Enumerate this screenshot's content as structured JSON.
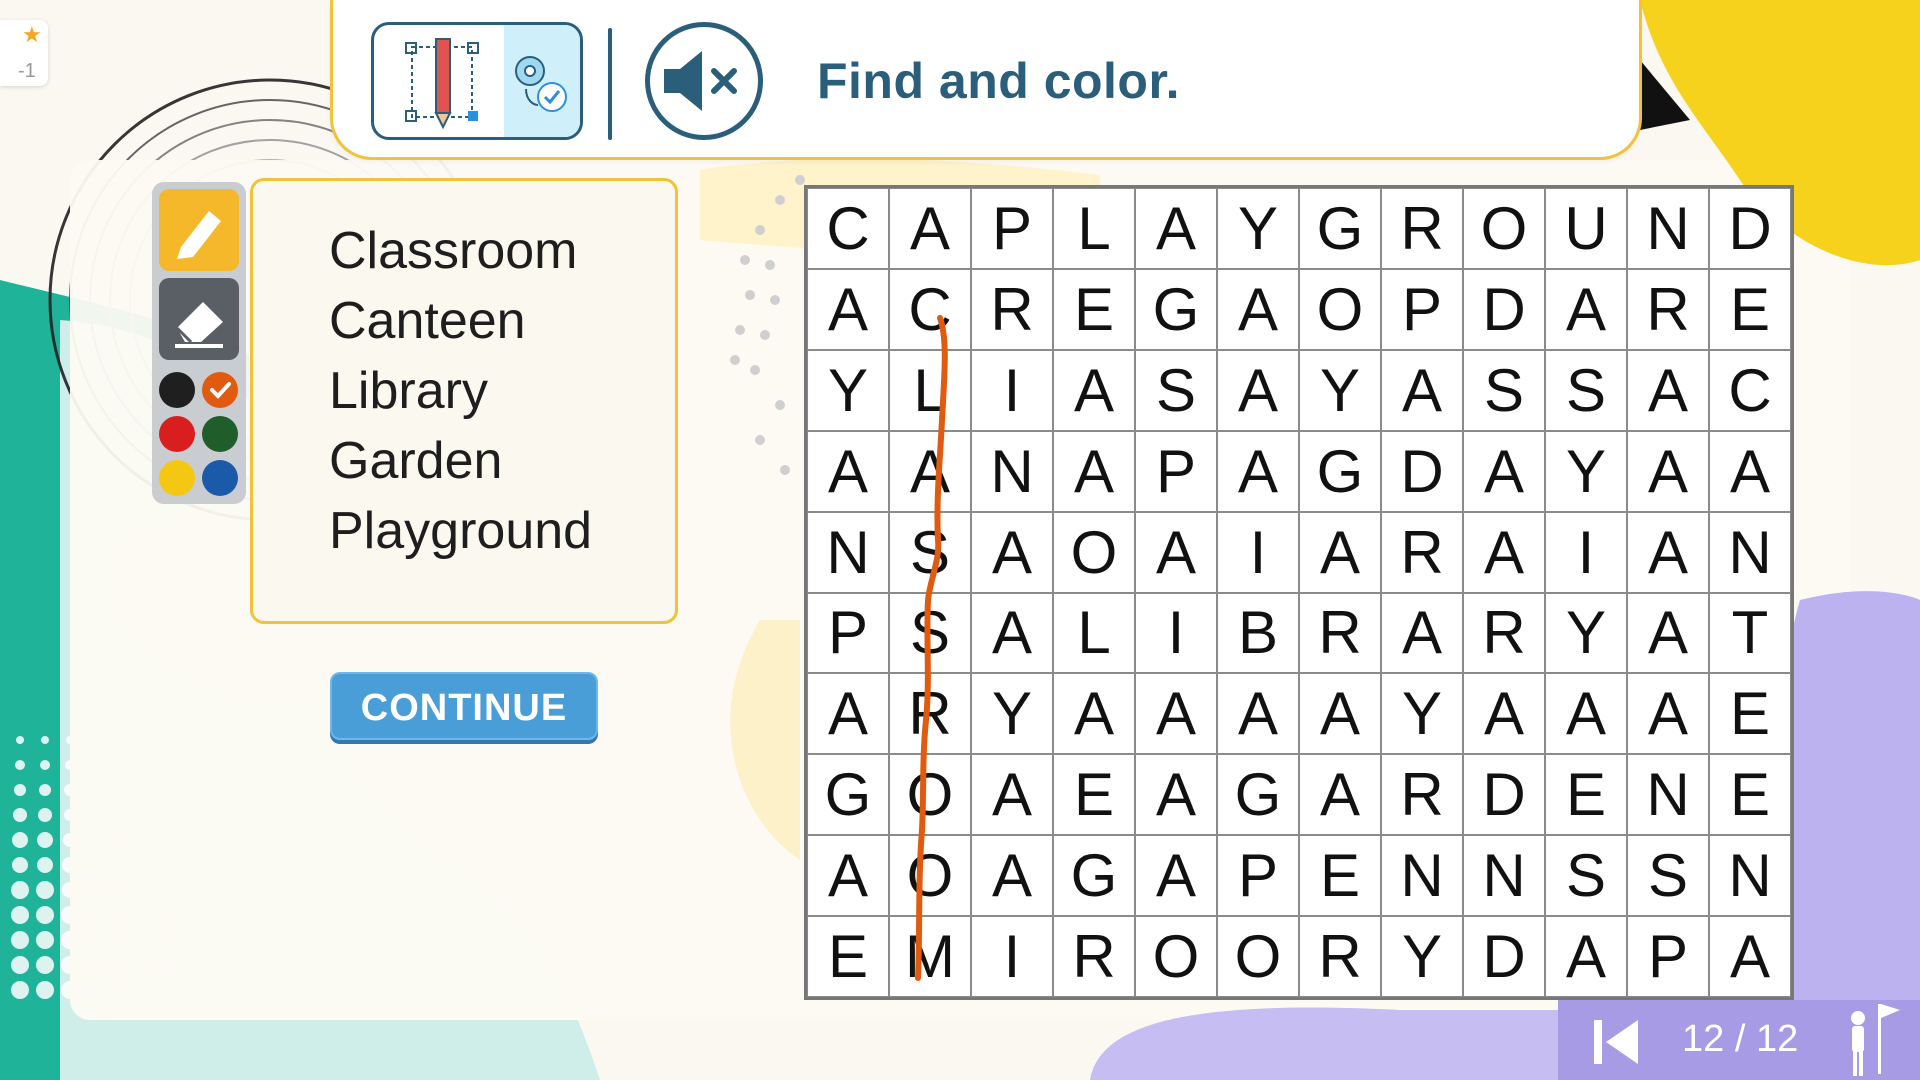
{
  "header": {
    "instruction": "Find and color.",
    "tool_icon": "pencil-select-icon",
    "settings_icon": "gear-check-icon",
    "mute_icon": "speaker-muted-icon"
  },
  "palette": {
    "tools": [
      "pencil-icon",
      "eraser-icon"
    ],
    "colors": [
      "#1f1f1f",
      "#e05a10",
      "#d81e1e",
      "#1f5e2a",
      "#f4c712",
      "#1a5aa8"
    ],
    "selected_color": "#e05a10"
  },
  "word_list": [
    "Classroom",
    "Canteen",
    "Library",
    "Garden",
    "Playground"
  ],
  "continue_label": "CONTINUE",
  "grid": [
    [
      "C",
      "A",
      "P",
      "L",
      "A",
      "Y",
      "G",
      "R",
      "O",
      "U",
      "N",
      "D"
    ],
    [
      "A",
      "C",
      "R",
      "E",
      "G",
      "A",
      "O",
      "P",
      "D",
      "A",
      "R",
      "E"
    ],
    [
      "Y",
      "L",
      "I",
      "A",
      "S",
      "A",
      "Y",
      "A",
      "S",
      "S",
      "A",
      "C"
    ],
    [
      "A",
      "A",
      "N",
      "A",
      "P",
      "A",
      "G",
      "D",
      "A",
      "Y",
      "A",
      "A"
    ],
    [
      "N",
      "S",
      "A",
      "O",
      "A",
      "I",
      "A",
      "R",
      "A",
      "I",
      "A",
      "N"
    ],
    [
      "P",
      "S",
      "A",
      "L",
      "I",
      "B",
      "R",
      "A",
      "R",
      "Y",
      "A",
      "T"
    ],
    [
      "A",
      "R",
      "Y",
      "A",
      "A",
      "A",
      "A",
      "Y",
      "A",
      "A",
      "A",
      "E"
    ],
    [
      "G",
      "O",
      "A",
      "E",
      "A",
      "G",
      "A",
      "R",
      "D",
      "E",
      "N",
      "E"
    ],
    [
      "A",
      "O",
      "A",
      "G",
      "A",
      "P",
      "E",
      "N",
      "N",
      "S",
      "S",
      "N"
    ],
    [
      "E",
      "M",
      "I",
      "R",
      "O",
      "O",
      "R",
      "Y",
      "D",
      "A",
      "P",
      "A"
    ]
  ],
  "stroke_color": "#e05a10",
  "nav": {
    "page": "12 / 12",
    "prev_icon": "skip-previous-icon",
    "goal_icon": "flag-person-icon"
  },
  "corner": {
    "value": "-1",
    "icon": "star-icon"
  }
}
